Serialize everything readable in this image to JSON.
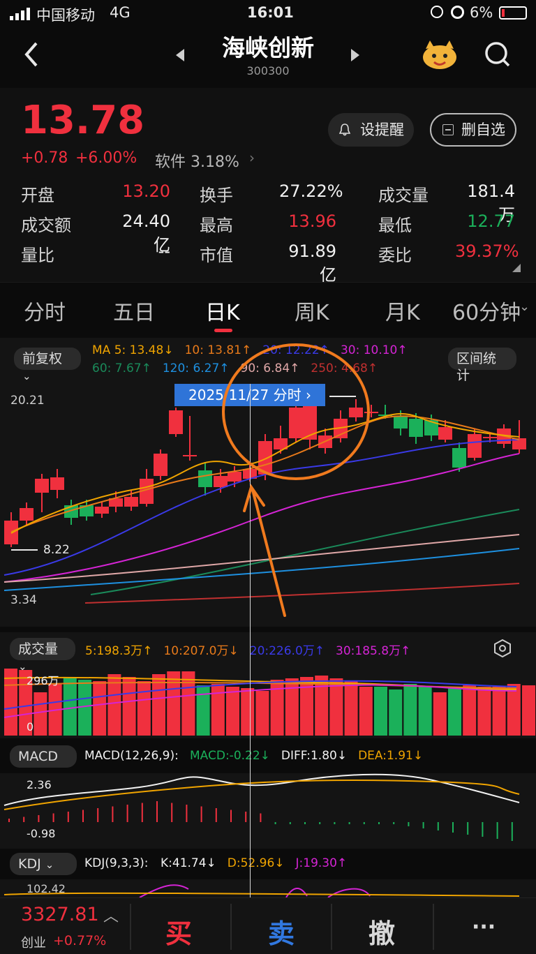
{
  "status": {
    "carrier": "中国移动",
    "network": "4G",
    "time": "16:01",
    "battery": "6%"
  },
  "nav": {
    "title": "海峡创新",
    "code": "300300",
    "icons": [
      "back-icon",
      "prev-arrow-icon",
      "next-arrow-icon",
      "mascot-icon",
      "search-icon"
    ]
  },
  "quote": {
    "price": "13.78",
    "change": "+0.78",
    "change_pct": "+6.00%",
    "sector": "软件 3.18%",
    "alert_label": "设提醒",
    "remove_label": "删自选",
    "rows": [
      [
        {
          "label": "开盘",
          "value": "13.20",
          "color": "red"
        },
        {
          "label": "换手",
          "value": "27.22%",
          "color": "white"
        },
        {
          "label": "成交量",
          "value": "181.4万",
          "color": "white"
        }
      ],
      [
        {
          "label": "成交额",
          "value": "24.40亿",
          "color": "white"
        },
        {
          "label": "最高",
          "value": "13.96",
          "color": "red"
        },
        {
          "label": "最低",
          "value": "12.77",
          "color": "green"
        }
      ],
      [
        {
          "label": "量比",
          "value": "--",
          "color": "white"
        },
        {
          "label": "市值",
          "value": "91.89亿",
          "color": "white"
        },
        {
          "label": "委比",
          "value": "39.37%",
          "color": "red"
        }
      ]
    ]
  },
  "tabs": [
    "分时",
    "五日",
    "日K",
    "周K",
    "月K",
    "60分钟"
  ],
  "active_tab": "日K",
  "kline": {
    "adjust_label": "前复权",
    "stats_label": "区间统计",
    "ma_row1": [
      {
        "t": "MA 5: 13.48↓",
        "c": "#f0a400"
      },
      {
        "t": "10: 13.81↑",
        "c": "#e87a1a"
      },
      {
        "t": "20: 12.22↑",
        "c": "#3a3ae8"
      },
      {
        "t": "30: 10.10↑",
        "c": "#d524d5"
      }
    ],
    "ma_row2": [
      {
        "t": "60: 7.67↑",
        "c": "#1a8a5a"
      },
      {
        "t": "120: 6.27↑",
        "c": "#1e90e0"
      },
      {
        "t": "90: 6.84↑",
        "c": "#e0a8a8"
      },
      {
        "t": "250: 4.68↑",
        "c": "#c03030"
      }
    ],
    "tooltip": "2025/11/27  分时 ›",
    "y_high": "20.21",
    "y_mid": "8.22",
    "y_low": "3.34"
  },
  "volume": {
    "label": "成交量",
    "y_top": "296万",
    "y_bottom": "0",
    "legend": [
      {
        "t": "5:198.3万↑",
        "c": "#f0a400"
      },
      {
        "t": "10:207.0万↓",
        "c": "#e87a1a"
      },
      {
        "t": "20:226.0万↑",
        "c": "#3a3ae8"
      },
      {
        "t": "30:185.8万↑",
        "c": "#d524d5"
      }
    ]
  },
  "macd": {
    "label": "MACD",
    "params": "MACD(12,26,9):",
    "legend": [
      {
        "t": "MACD:-0.22↓",
        "c": "#1bb05a"
      },
      {
        "t": "DIFF:1.80↓",
        "c": "#f2f2f2"
      },
      {
        "t": "DEA:1.91↓",
        "c": "#f0a400"
      }
    ],
    "y_top": "2.36",
    "y_bottom": "-0.98"
  },
  "kdj": {
    "label": "KDJ",
    "params": "KDJ(9,3,3):",
    "legend": [
      {
        "t": "K:41.74↓",
        "c": "#f2f2f2"
      },
      {
        "t": "D:52.96↓",
        "c": "#f0a400"
      },
      {
        "t": "J:19.30↑",
        "c": "#d524d5"
      }
    ],
    "y_top": "102.42"
  },
  "bottom": {
    "index_value": "3327.81",
    "index_name": "创业",
    "index_change": "+0.77%",
    "buy": "买",
    "sell": "卖",
    "cancel": "撤",
    "more": "···"
  }
}
